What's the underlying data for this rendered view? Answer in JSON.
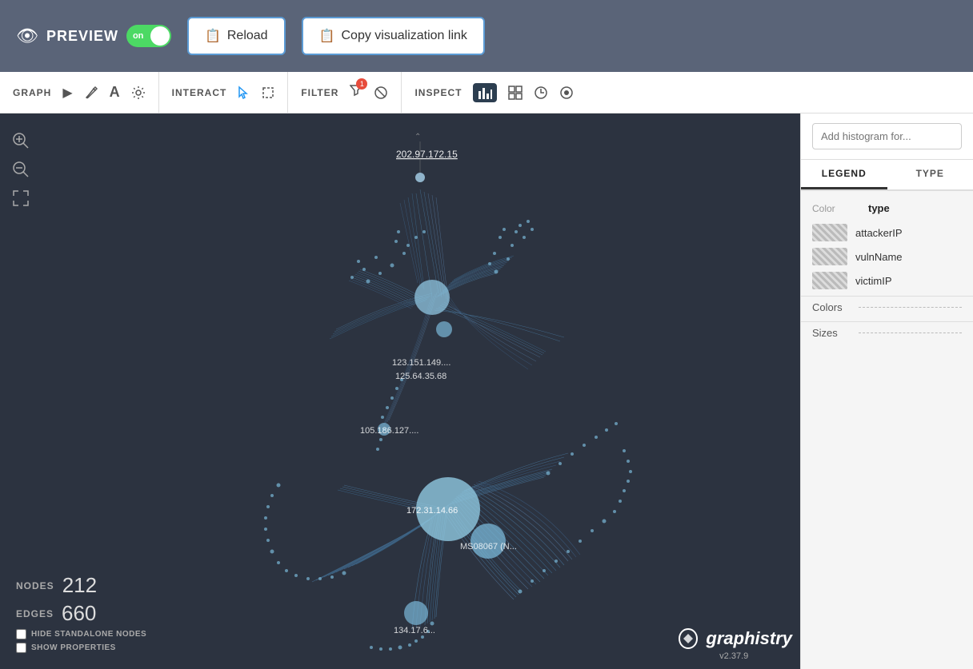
{
  "topbar": {
    "preview_label": "PREVIEW",
    "toggle_state": "on",
    "reload_btn": "Reload",
    "copy_link_btn": "Copy visualization link"
  },
  "toolbar": {
    "graph_label": "GRAPH",
    "interact_label": "INTERACT",
    "filter_label": "FILTER",
    "filter_count": "1",
    "inspect_label": "INSPECT"
  },
  "graph": {
    "nodes_label": "NODES",
    "nodes_value": "212",
    "edges_label": "EDGES",
    "edges_value": "660",
    "hide_standalone_label": "HIDE STANDALONE NODES",
    "show_properties_label": "SHOW PROPERTIES",
    "node_labels": [
      "202.97.172.15",
      "123.151.149....",
      "125.64.35.68",
      "105.186.127....",
      "172.31.14.66",
      "MS08067 (N...",
      "134.17.6..."
    ],
    "watermark_name": "graphistry",
    "watermark_version": "v2.37.9"
  },
  "right_panel": {
    "histogram_placeholder": "Add histogram for...",
    "tab_legend": "LEGEND",
    "tab_type": "TYPE",
    "color_header": "Color",
    "type_header": "type",
    "legend_items": [
      {
        "label": "attackerIP"
      },
      {
        "label": "vulnName"
      },
      {
        "label": "victimIP"
      }
    ],
    "colors_label": "Colors",
    "sizes_label": "Sizes"
  },
  "icons": {
    "eye": "👁",
    "play": "▶",
    "brush": "🖌",
    "text": "A",
    "settings": "⚙",
    "cursor": "➤",
    "rect": "□",
    "funnel": "⊲",
    "ban": "⊘",
    "bar_chart": "📊",
    "grid": "⊞",
    "clock": "○",
    "circle_dot": "●",
    "zoom_in": "⊕",
    "zoom_out": "⊖",
    "move": "✛"
  }
}
